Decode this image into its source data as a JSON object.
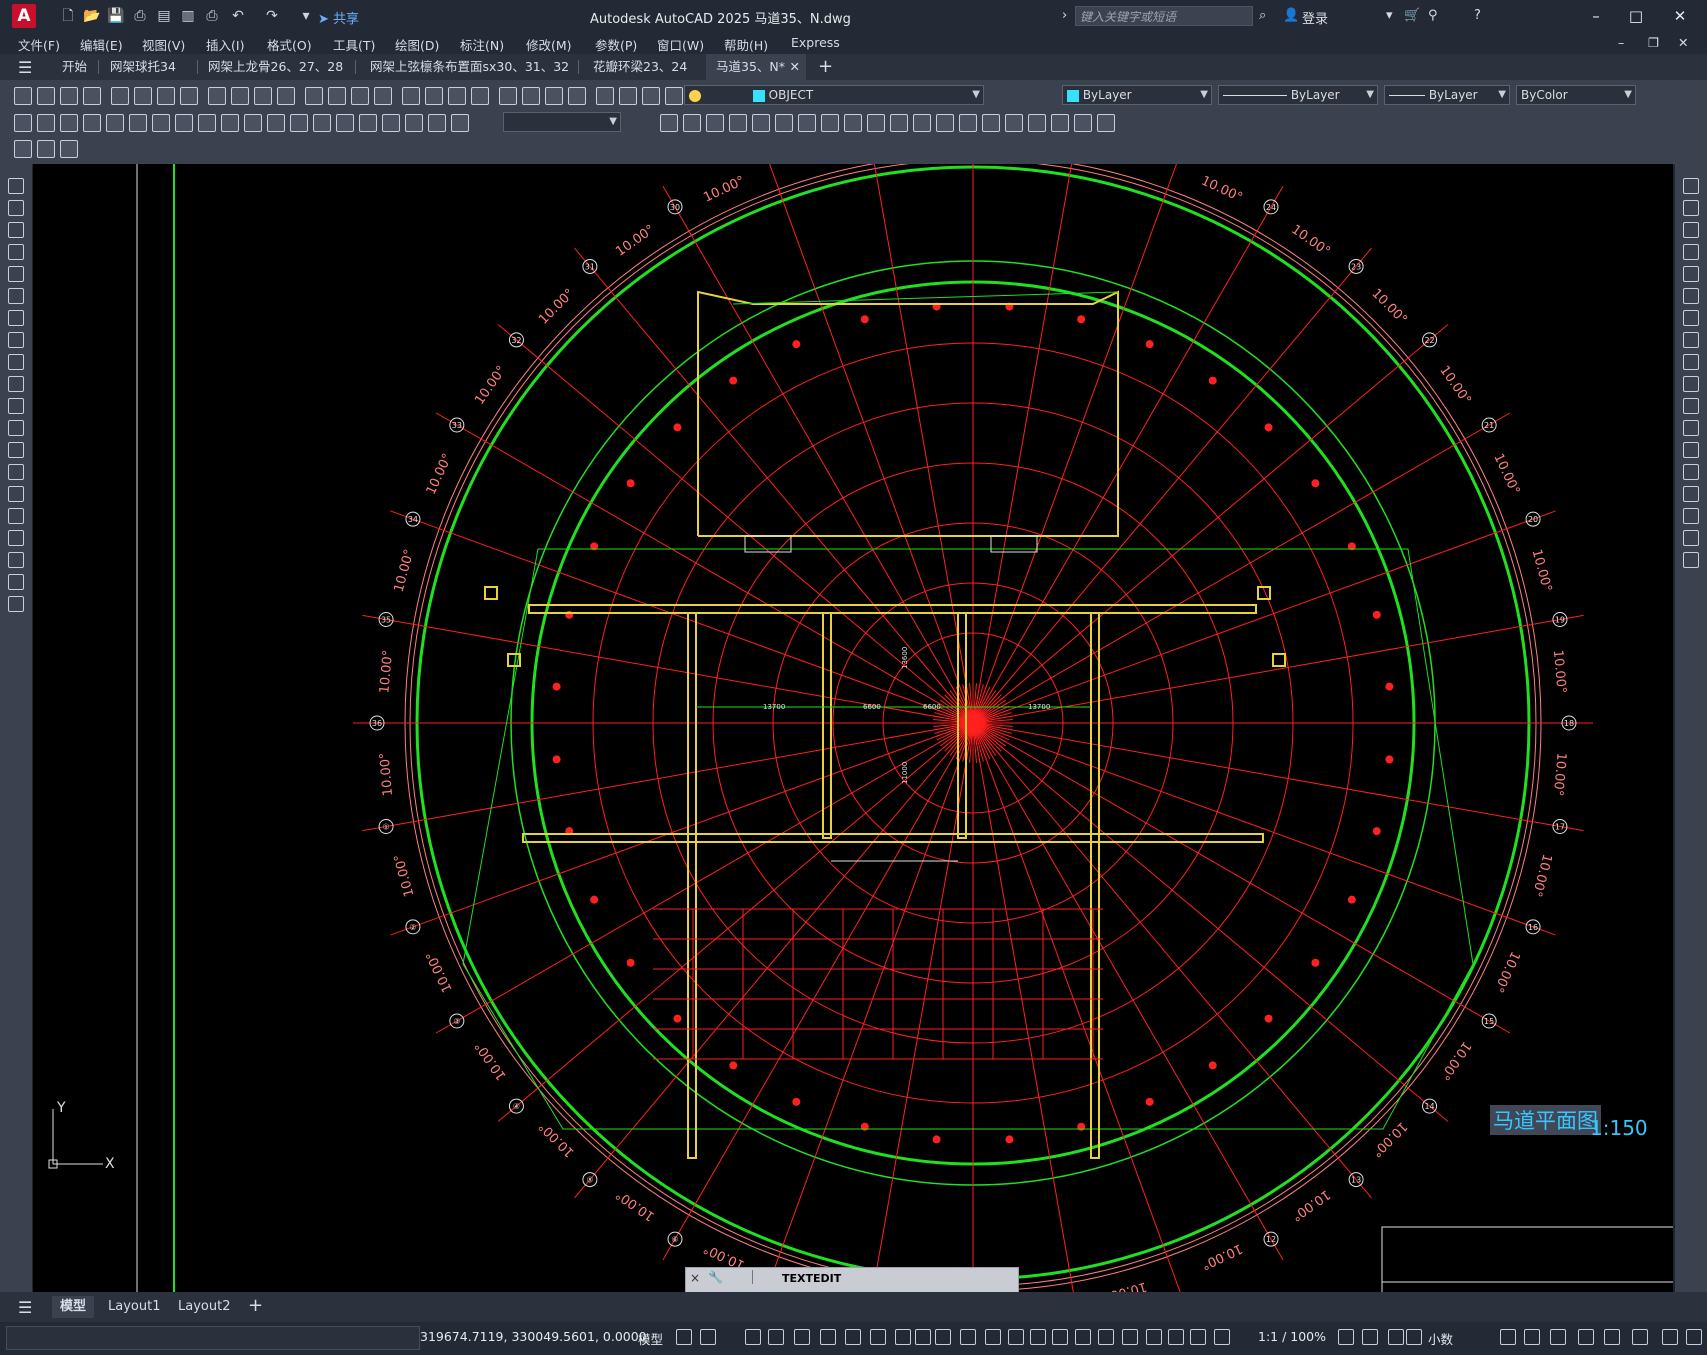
{
  "app": {
    "logo_letter": "A",
    "title": "Autodesk AutoCAD 2025    马道35、N.dwg",
    "share_label": "共享",
    "search_placeholder": "键入关键字或短语",
    "login_label": "登录",
    "window_controls": [
      "–",
      "□",
      "✕"
    ]
  },
  "menu": [
    "文件(F)",
    "编辑(E)",
    "视图(V)",
    "插入(I)",
    "格式(O)",
    "工具(T)",
    "绘图(D)",
    "标注(N)",
    "修改(M)",
    "参数(P)",
    "窗口(W)",
    "帮助(H)",
    "Express"
  ],
  "tabs": [
    {
      "label": "开始"
    },
    {
      "label": "网架球托34"
    },
    {
      "label": "网架上龙骨26、27、28"
    },
    {
      "label": "网架上弦檩条布置面sx30、31、32"
    },
    {
      "label": "花瓣环梁23、24"
    },
    {
      "label": "马道35、N*",
      "active": true
    }
  ],
  "properties": {
    "layer": "OBJECT",
    "color": "ByLayer",
    "linetype": "ByLayer",
    "lineweight": "ByLayer",
    "plotstyle": "ByColor"
  },
  "drawing": {
    "title": "马道平面图",
    "scale": "1:150",
    "axis_labels": [
      "30",
      "31",
      "32",
      "33",
      "34",
      "35",
      "36",
      "①",
      "②",
      "③",
      "④",
      "⑤",
      "⑥",
      "24",
      "23",
      "22",
      "21",
      "20",
      "19",
      "18",
      "17",
      "16",
      "15",
      "14",
      "13",
      "12"
    ],
    "angle_label": "10.00°",
    "dimension_labels": [
      "13700",
      "6600",
      "6600",
      "13700",
      "13600",
      "11000"
    ],
    "colors": {
      "red": "#ff2020",
      "green": "#20e020",
      "yellow": "#e6d23a",
      "pink": "#ff8080",
      "cyan": "#38c6ff"
    }
  },
  "command": {
    "text": "TEXTEDIT",
    "close": "×"
  },
  "layout_tabs": [
    {
      "label": "模型",
      "active": true
    },
    {
      "label": "Layout1"
    },
    {
      "label": "Layout2"
    }
  ],
  "status": {
    "coords": "319674.7119, 330049.5601, 0.0000",
    "model": "模型",
    "annoscale": "1:1 / 100%",
    "units": "小数"
  },
  "ucs": {
    "x": "X",
    "y": "Y"
  }
}
